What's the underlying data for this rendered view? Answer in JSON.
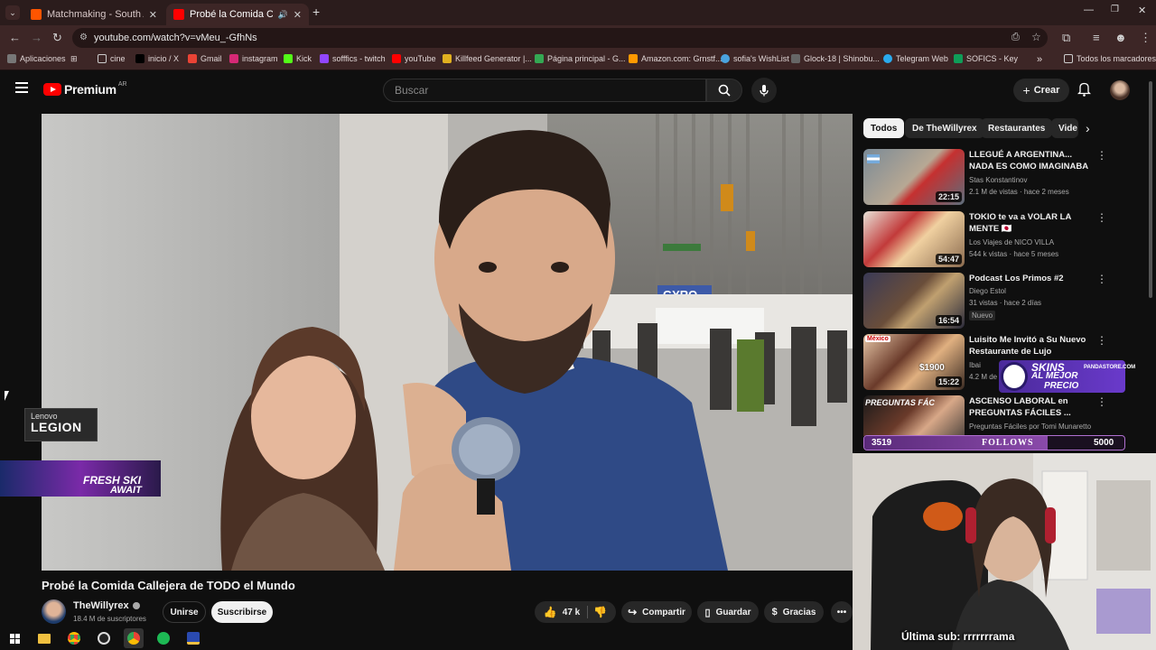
{
  "browser": {
    "tabs": [
      {
        "label": "Matchmaking - South America",
        "active": false
      },
      {
        "label": "Probé la Comida Callejera d",
        "active": true
      }
    ],
    "url": "youtube.com/watch?v=vMeu_-GfhNs",
    "bookmarks": [
      "Aplicaciones",
      "cine",
      "inicio / X",
      "Gmail",
      "instagram",
      "Kick",
      "sofffics - twitch",
      "youTube",
      "Killfeed Generator |...",
      "Página principal - G...",
      "Amazon.com: Grnstf...",
      "sofia's WishList",
      "Glock-18 | Shinobu...",
      "Telegram Web",
      "SOFICS - Key"
    ],
    "all_bookmarks": "Todos los marcadores"
  },
  "youtube": {
    "logo_text": "Premium",
    "region": "AR",
    "search_placeholder": "Buscar",
    "create_label": "Crear"
  },
  "overlays": {
    "lenovo_brand": "Lenovo",
    "legion": "LEGION",
    "fresh_banner_1": "FRESH SKI",
    "fresh_banner_2": "AWAIT",
    "skins_1": "SKINS",
    "skins_2": "AL MEJOR",
    "skins_3": "PRECIO",
    "skins_site": "PANDASTORE.COM",
    "follows_current": "3519",
    "follows_label": "FOLLOWS",
    "follows_goal": "5000",
    "follows_progress": 0.7038,
    "last_sub": "Última sub: rrrrrrrama"
  },
  "video": {
    "title": "Probé la Comida Callejera de TODO el Mundo",
    "channel": "TheWillyrex",
    "subscribers": "18.4 M de suscriptores",
    "join": "Unirse",
    "subscribe": "Suscribirse",
    "likes": "47 k",
    "share": "Compartir",
    "save": "Guardar",
    "thanks": "Gracias",
    "scene_sign": "GYRO"
  },
  "chips": [
    "Todos",
    "De TheWillyrex",
    "Restaurantes",
    "Vide"
  ],
  "recommendations": [
    {
      "title": "LLEGUÉ A ARGENTINA... NADA ES COMO IMAGINABA",
      "channel": "Stas Konstantinov",
      "meta": "2.1 M de vistas · hace 2 meses",
      "duration": "22:15"
    },
    {
      "title": "TOKIO te va a VOLAR LA MENTE 🇯🇵",
      "channel": "Los Viajes de NICO VILLA",
      "meta": "544 k vistas · hace 5 meses",
      "duration": "54:47"
    },
    {
      "title": "Podcast Los Primos #2",
      "channel": "Diego Estol",
      "meta": "31 vistas · hace 2 días",
      "badge": "Nuevo",
      "duration": "16:54"
    },
    {
      "title": "Luisito Me Invitó a Su Nuevo Restaurante de Lujo",
      "channel": "Ibai",
      "meta": "4.2 M de",
      "duration": "15:22",
      "thumb_label": "México",
      "thumb_price": "$1900"
    },
    {
      "title": "ASCENSO LABORAL en PREGUNTAS FÁCILES ...",
      "channel": "Preguntas Fáciles por Tomi Munaretto",
      "meta": "",
      "duration": "",
      "thumb_label": "PREGUNTAS FÁC"
    }
  ]
}
